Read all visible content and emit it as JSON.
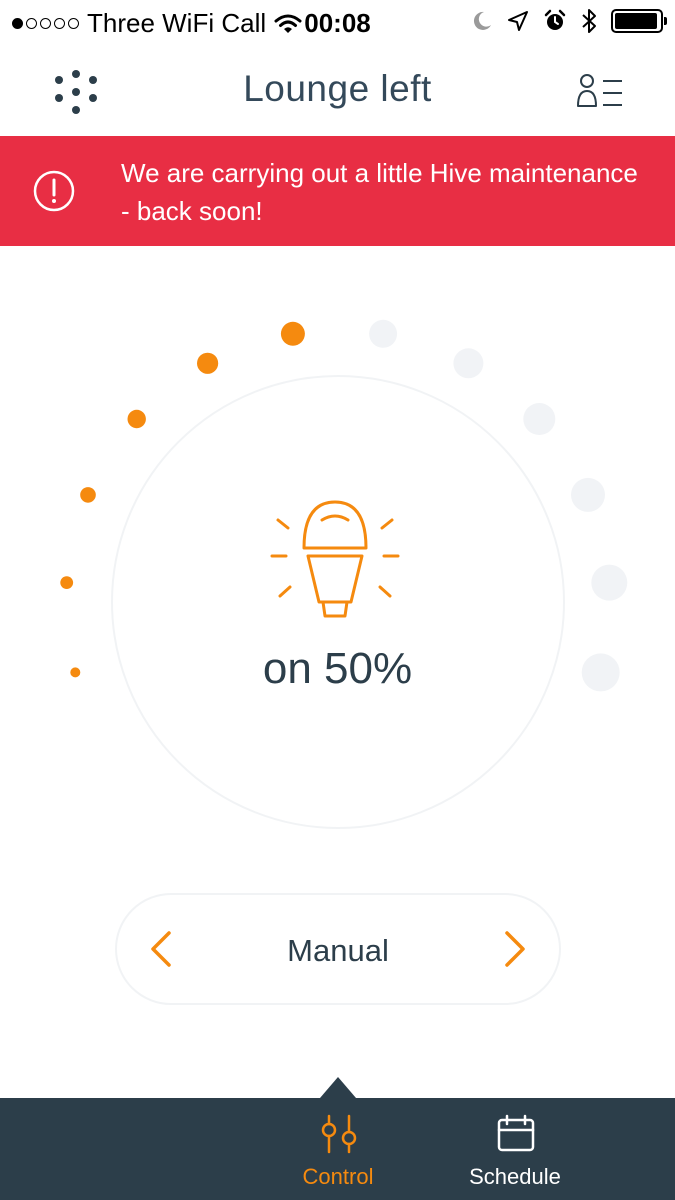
{
  "status_bar": {
    "carrier": "Three WiFi Call",
    "time": "00:08",
    "signal_bars_filled": 1,
    "signal_bars_total": 5,
    "battery_level": 0.95,
    "icons": [
      "wifi-icon",
      "moon-icon",
      "location-arrow-icon",
      "alarm-icon",
      "bluetooth-icon",
      "battery-icon"
    ]
  },
  "nav": {
    "title": "Lounge left",
    "menu_icon": "hive-dots-icon",
    "account_icon": "account-list-icon"
  },
  "banner": {
    "message": "We are carrying out a little Hive maintenance - back soon!",
    "icon": "alert-circle-icon",
    "color": "#e82e44"
  },
  "dial": {
    "value_label": "on 50%",
    "brightness_percent": 50,
    "steps_total": 12,
    "steps_active": 6,
    "active_color": "#f58a0f",
    "inactive_color": "#f1f3f6",
    "icon": "light-bulb-icon"
  },
  "mode": {
    "label": "Manual",
    "prev_icon": "chevron-left-icon",
    "next_icon": "chevron-right-icon"
  },
  "tabs": [
    {
      "label": "Control",
      "icon": "sliders-icon",
      "active": true
    },
    {
      "label": "Schedule",
      "icon": "calendar-icon",
      "active": false
    }
  ],
  "colors": {
    "accent": "#f58a0f",
    "dark": "#2c3e4a",
    "alert": "#e82e44"
  }
}
